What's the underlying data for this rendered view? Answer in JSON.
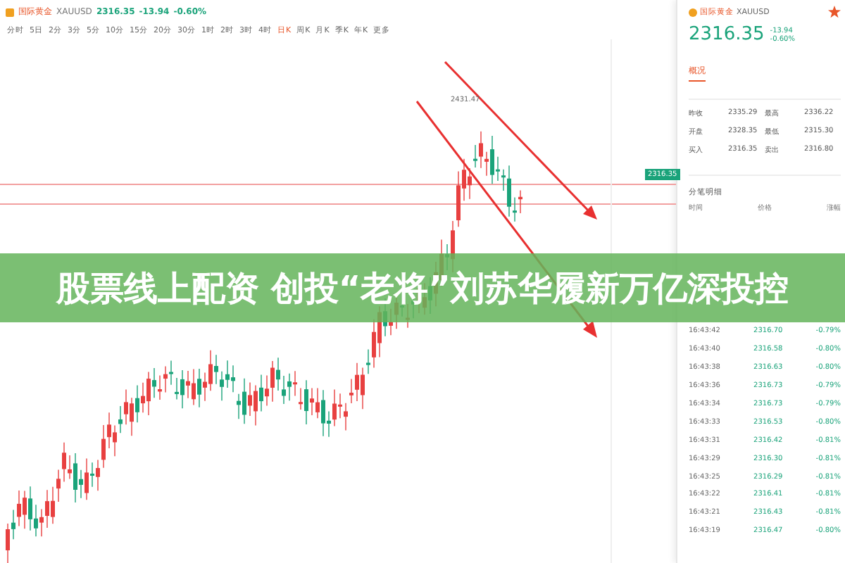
{
  "header": {
    "name": "国际黄金",
    "code": "XAUUSD",
    "price": "2316.35",
    "change": "-13.94",
    "percent": "-0.60%"
  },
  "periods": [
    {
      "label": "分时",
      "selected": false
    },
    {
      "label": "5日",
      "selected": false
    },
    {
      "label": "2分",
      "selected": false
    },
    {
      "label": "3分",
      "selected": false
    },
    {
      "label": "5分",
      "selected": false
    },
    {
      "label": "10分",
      "selected": false
    },
    {
      "label": "15分",
      "selected": false
    },
    {
      "label": "20分",
      "selected": false
    },
    {
      "label": "30分",
      "selected": false
    },
    {
      "label": "1时",
      "selected": false
    },
    {
      "label": "2时",
      "selected": false
    },
    {
      "label": "3时",
      "selected": false
    },
    {
      "label": "4时",
      "selected": false
    },
    {
      "label": "日K",
      "selected": true
    },
    {
      "label": "周K",
      "selected": false
    },
    {
      "label": "月K",
      "selected": false
    },
    {
      "label": "季K",
      "selected": false
    },
    {
      "label": "年K",
      "selected": false
    },
    {
      "label": "更多",
      "selected": false
    }
  ],
  "chart": {
    "peak_label": "2431.47",
    "price_tag": "2316.35"
  },
  "panel": {
    "name": "国际黄金",
    "code": "XAUUSD",
    "price": "2316.35",
    "change": "-13.94",
    "percent": "-0.60%",
    "tab": "概况",
    "stats": [
      {
        "label": "昨收",
        "value": "2335.29",
        "label2": "最高",
        "value2": "2336.22"
      },
      {
        "label": "开盘",
        "value": "2328.35",
        "label2": "最低",
        "value2": "2315.30"
      },
      {
        "label": "买入",
        "value": "2316.35",
        "label2": "卖出",
        "value2": "2316.80"
      }
    ],
    "ticks_title": "分笔明细",
    "columns": [
      "时间",
      "价格",
      "涨幅"
    ],
    "rows": [
      {
        "time": "16:43:42",
        "price": "2316.70",
        "change": "-0.79%"
      },
      {
        "time": "16:43:40",
        "price": "2316.58",
        "change": "-0.80%"
      },
      {
        "time": "16:43:38",
        "price": "2316.63",
        "change": "-0.80%"
      },
      {
        "time": "16:43:36",
        "price": "2316.73",
        "change": "-0.79%"
      },
      {
        "time": "16:43:34",
        "price": "2316.73",
        "change": "-0.79%"
      },
      {
        "time": "16:43:33",
        "price": "2316.53",
        "change": "-0.80%"
      },
      {
        "time": "16:43:31",
        "price": "2316.42",
        "change": "-0.81%"
      },
      {
        "time": "16:43:29",
        "price": "2316.30",
        "change": "-0.81%"
      },
      {
        "time": "16:43:25",
        "price": "2316.29",
        "change": "-0.81%"
      },
      {
        "time": "16:43:22",
        "price": "2316.41",
        "change": "-0.81%"
      },
      {
        "time": "16:43:21",
        "price": "2316.43",
        "change": "-0.81%"
      },
      {
        "time": "16:43:19",
        "price": "2316.47",
        "change": "-0.80%"
      }
    ]
  },
  "banner": {
    "headline": "股票线上配资 创投“老将”刘苏华履新万亿深投控"
  }
}
